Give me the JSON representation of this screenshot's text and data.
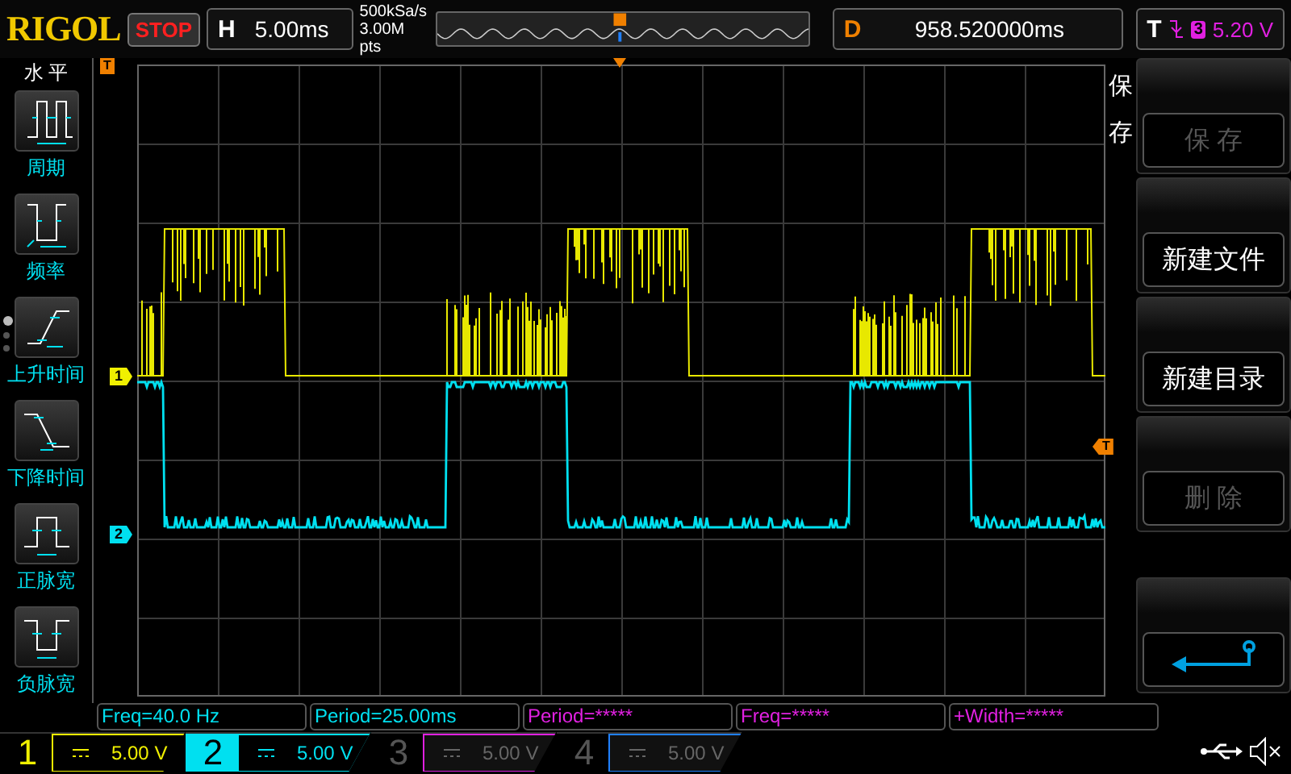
{
  "header": {
    "logo": "RIGOL",
    "run_state": "STOP",
    "horizontal": {
      "label": "H",
      "value": "5.00ms"
    },
    "sample_rate": "500kSa/s",
    "memory_depth": "3.00M pts",
    "delay": {
      "label": "D",
      "value": "958.520000ms"
    },
    "trigger": {
      "label": "T",
      "source": "3",
      "level": "5.20 V"
    }
  },
  "left_menu": {
    "title": "水 平",
    "items": [
      {
        "kind": "period",
        "label": "周期"
      },
      {
        "kind": "frequency",
        "label": "频率"
      },
      {
        "kind": "rise",
        "label": "上升时间"
      },
      {
        "kind": "fall",
        "label": "下降时间"
      },
      {
        "kind": "pwidth",
        "label": "正脉宽"
      },
      {
        "kind": "nwidth",
        "label": "负脉宽"
      }
    ],
    "pages": [
      {
        "selected": true
      },
      {
        "selected": false
      },
      {
        "selected": false
      }
    ]
  },
  "scope": {
    "channel_markers": [
      {
        "label": "1",
        "color": "#f0f000"
      },
      {
        "label": "2",
        "color": "#00e0f0"
      }
    ],
    "trigger_marker": "T",
    "trigger_level_marker": "T"
  },
  "right_menu": {
    "title": "保存",
    "buttons": [
      {
        "kind": "text",
        "label": "保 存",
        "disabled": true
      },
      {
        "kind": "text",
        "label": "新建文件",
        "disabled": false
      },
      {
        "kind": "text",
        "label": "新建目录",
        "disabled": false
      },
      {
        "kind": "text",
        "label": "删 除",
        "disabled": true
      },
      {
        "kind": "back",
        "disabled": false
      }
    ]
  },
  "measurements": [
    {
      "text": "Freq=40.0 Hz",
      "color": "#00e0f0"
    },
    {
      "text": "Period=25.00ms",
      "color": "#00e0f0"
    },
    {
      "text": "Period=*****",
      "color": "#e020e0"
    },
    {
      "text": "Freq=*****",
      "color": "#e020e0"
    },
    {
      "text": "+Width=*****",
      "color": "#e020e0"
    }
  ],
  "channels": [
    {
      "number": "1",
      "scale": "5.00 V",
      "color": "#f0f000",
      "enabled": true,
      "selected": false
    },
    {
      "number": "2",
      "scale": "5.00 V",
      "color": "#00e0f0",
      "enabled": true,
      "selected": true
    },
    {
      "number": "3",
      "scale": "5.00 V",
      "color": "#e020e0",
      "enabled": false,
      "selected": false
    },
    {
      "number": "4",
      "scale": "5.00 V",
      "color": "#2080ff",
      "enabled": false,
      "selected": false
    }
  ]
}
